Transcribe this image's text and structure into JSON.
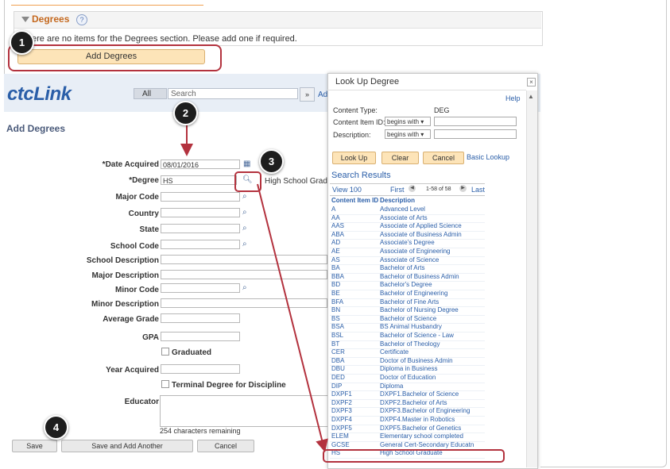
{
  "top_section": {
    "title": "Degrees",
    "help": "?",
    "message": "ere are no items for the Degrees section.  Please add one if required.",
    "add_button": "Add Degrees"
  },
  "header": {
    "logo": "ctcLink",
    "search_scope": "All",
    "search_placeholder": "Search",
    "go": "»",
    "add_fragment": "Ad"
  },
  "form": {
    "title": "Add Degrees",
    "fields": {
      "date_acquired": {
        "label": "*Date Acquired",
        "value": "08/01/2016"
      },
      "degree": {
        "label": "*Degree",
        "value": "HS",
        "desc": "High School Graduat"
      },
      "major_code": {
        "label": "Major Code"
      },
      "country": {
        "label": "Country"
      },
      "state": {
        "label": "State"
      },
      "school_code": {
        "label": "School Code"
      },
      "school_description": {
        "label": "School Description"
      },
      "major_description": {
        "label": "Major Description"
      },
      "minor_code": {
        "label": "Minor Code"
      },
      "minor_description": {
        "label": "Minor Description"
      },
      "average_grade": {
        "label": "Average Grade"
      },
      "gpa": {
        "label": "GPA"
      },
      "graduated": {
        "label": "Graduated"
      },
      "year_acquired": {
        "label": "Year Acquired"
      },
      "terminal_degree": {
        "label": "Terminal Degree for Discipline"
      },
      "educator": {
        "label": "Educator"
      }
    },
    "chars_remaining": "254 characters remaining",
    "buttons": {
      "save": "Save",
      "save_add": "Save and Add Another",
      "cancel": "Cancel"
    }
  },
  "dialog": {
    "title": "Look Up Degree",
    "close": "×",
    "help": "Help",
    "content_type_label": "Content Type:",
    "content_type_value": "DEG",
    "item_id_label": "Content Item ID:",
    "item_id_op": "begins with ▾",
    "desc_label": "Description:",
    "desc_op": "begins with ▾",
    "buttons": {
      "lookup": "Look Up",
      "clear": "Clear",
      "cancel": "Cancel",
      "basic": "Basic Lookup"
    },
    "results_title": "Search Results",
    "nav": {
      "view": "View 100",
      "first": "First",
      "range": "1-58 of 58",
      "last": "Last"
    },
    "col_id": "Content Item ID",
    "col_desc": "Description",
    "rows": [
      {
        "id": "A",
        "desc": "Advanced Level"
      },
      {
        "id": "AA",
        "desc": "Associate of Arts"
      },
      {
        "id": "AAS",
        "desc": "Associate of Applied Science"
      },
      {
        "id": "ABA",
        "desc": "Associate of Business Admin"
      },
      {
        "id": "AD",
        "desc": "Associate's Degree"
      },
      {
        "id": "AE",
        "desc": "Associate of Engineering"
      },
      {
        "id": "AS",
        "desc": "Associate of Science"
      },
      {
        "id": "BA",
        "desc": "Bachelor of Arts"
      },
      {
        "id": "BBA",
        "desc": "Bachelor of Business Admin"
      },
      {
        "id": "BD",
        "desc": "Bachelor's Degree"
      },
      {
        "id": "BE",
        "desc": "Bachelor of Engineering"
      },
      {
        "id": "BFA",
        "desc": "Bachelor of Fine Arts"
      },
      {
        "id": "BN",
        "desc": "Bachelor of Nursing Degree"
      },
      {
        "id": "BS",
        "desc": "Bachelor of Science"
      },
      {
        "id": "BSA",
        "desc": "BS Animal Husbandry"
      },
      {
        "id": "BSL",
        "desc": "Bachelor of Science - Law"
      },
      {
        "id": "BT",
        "desc": "Bachelor of Theology"
      },
      {
        "id": "CER",
        "desc": "Certificate"
      },
      {
        "id": "DBA",
        "desc": "Doctor of Business Admin"
      },
      {
        "id": "DBU",
        "desc": "Diploma in Business"
      },
      {
        "id": "DED",
        "desc": "Doctor of Education"
      },
      {
        "id": "DIP",
        "desc": "Diploma"
      },
      {
        "id": "DXPF1",
        "desc": "DXPF1.Bachelor of Science"
      },
      {
        "id": "DXPF2",
        "desc": "DXPF2.Bachelor of Arts"
      },
      {
        "id": "DXPF3",
        "desc": "DXPF3.Bachelor of Engineering"
      },
      {
        "id": "DXPF4",
        "desc": "DXPF4.Master in Robotics"
      },
      {
        "id": "DXPF5",
        "desc": "DXPF5.Bachelor of Genetics"
      },
      {
        "id": "ELEM",
        "desc": "Elementary school completed"
      },
      {
        "id": "GCSE",
        "desc": "General Cert-Secondary Educatn"
      },
      {
        "id": "HS",
        "desc": "High School Graduate"
      }
    ]
  },
  "callouts": [
    "1",
    "2",
    "3",
    "4"
  ],
  "colors": {
    "highlight": "#b3323e",
    "link": "#2a5ea8",
    "accent_orange": "#c4681e",
    "button_orange": "#fde4b8"
  }
}
